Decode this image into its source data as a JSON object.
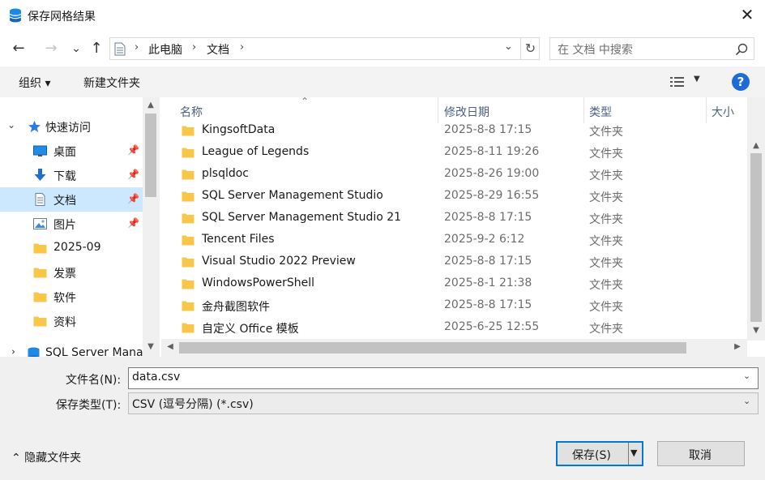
{
  "window": {
    "title": "保存网格结果",
    "close_glyph": "✕"
  },
  "nav": {
    "back_glyph": "←",
    "forward_glyph": "→",
    "recent_glyph": "⌄",
    "up_glyph": "↑",
    "breadcrumb": [
      "此电脑",
      "文档"
    ],
    "refresh_glyph": "↻",
    "search_placeholder": "在 文档 中搜索"
  },
  "command_bar": {
    "organize": "组织 ▾",
    "new_folder": "新建文件夹",
    "help_glyph": "?"
  },
  "sidebar": {
    "items": [
      {
        "label": "快速访问",
        "icon": "star-icon"
      },
      {
        "label": "桌面",
        "icon": "desktop-icon",
        "pinned": true
      },
      {
        "label": "下载",
        "icon": "download-icon",
        "pinned": true
      },
      {
        "label": "文档",
        "icon": "document-icon",
        "pinned": true,
        "selected": true
      },
      {
        "label": "图片",
        "icon": "pictures-icon",
        "pinned": true
      },
      {
        "label": "2025-09",
        "icon": "folder-icon"
      },
      {
        "label": "发票",
        "icon": "folder-icon"
      },
      {
        "label": "软件",
        "icon": "folder-icon"
      },
      {
        "label": "资料",
        "icon": "folder-icon"
      },
      {
        "label": "SQL Server Mana",
        "icon": "database-icon"
      }
    ]
  },
  "file_list": {
    "columns": [
      "名称",
      "修改日期",
      "类型",
      "大小"
    ],
    "rows": [
      {
        "name": "KingsoftData",
        "date": "2025-8-8 17:15",
        "type": "文件夹"
      },
      {
        "name": "League of Legends",
        "date": "2025-8-11 19:26",
        "type": "文件夹"
      },
      {
        "name": "plsqldoc",
        "date": "2025-8-26 19:00",
        "type": "文件夹"
      },
      {
        "name": "SQL Server Management Studio",
        "date": "2025-8-29 16:55",
        "type": "文件夹"
      },
      {
        "name": "SQL Server Management Studio 21",
        "date": "2025-8-8 17:15",
        "type": "文件夹"
      },
      {
        "name": "Tencent Files",
        "date": "2025-9-2 6:12",
        "type": "文件夹"
      },
      {
        "name": "Visual Studio 2022 Preview",
        "date": "2025-8-8 17:15",
        "type": "文件夹"
      },
      {
        "name": "WindowsPowerShell",
        "date": "2025-8-1 21:38",
        "type": "文件夹"
      },
      {
        "name": "金舟截图软件",
        "date": "2025-8-8 17:15",
        "type": "文件夹"
      },
      {
        "name": "自定义 Office 模板",
        "date": "2025-6-25 12:55",
        "type": "文件夹"
      }
    ]
  },
  "form": {
    "filename_label": "文件名(N):",
    "filename_value": "data.csv",
    "filetype_label": "保存类型(T):",
    "filetype_value": "CSV (逗号分隔) (*.csv)"
  },
  "footer": {
    "hide_folders": "⌃ 隐藏文件夹",
    "save": "保存(S)",
    "cancel": "取消"
  },
  "colors": {
    "selection": "#cce8ff",
    "accent": "#0078d4",
    "folder": "#f8c74a",
    "help": "#1d6bd8"
  }
}
